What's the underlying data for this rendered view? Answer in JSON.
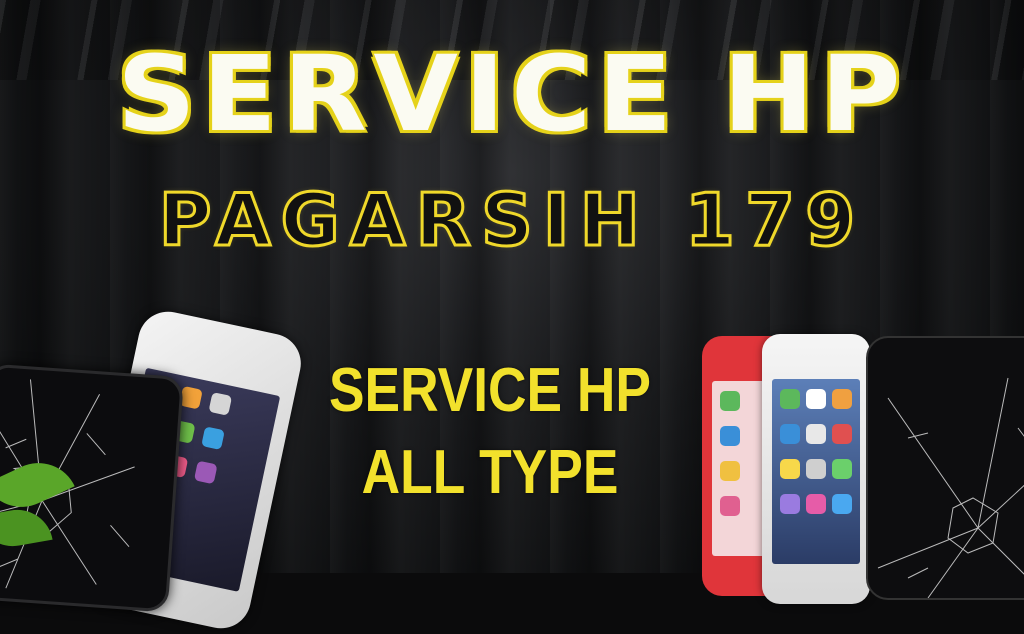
{
  "banner": {
    "title": "SERVICE HP",
    "subtitle": "PAGARSIH 179",
    "tagline_line1": "SERVICE HP",
    "tagline_line2": "ALL TYPE"
  },
  "colors": {
    "background": "#0b0b0c",
    "title_fill": "#fbfbf2",
    "title_outline": "#e5d21a",
    "subtitle_outline": "#efd82a",
    "tagline": "#f2e12c",
    "red_phone": "#e0353a",
    "leaf": "#5aa629"
  },
  "icons": [
    "cracked-phone-icon",
    "smartphone-icon",
    "leaf-icon"
  ]
}
